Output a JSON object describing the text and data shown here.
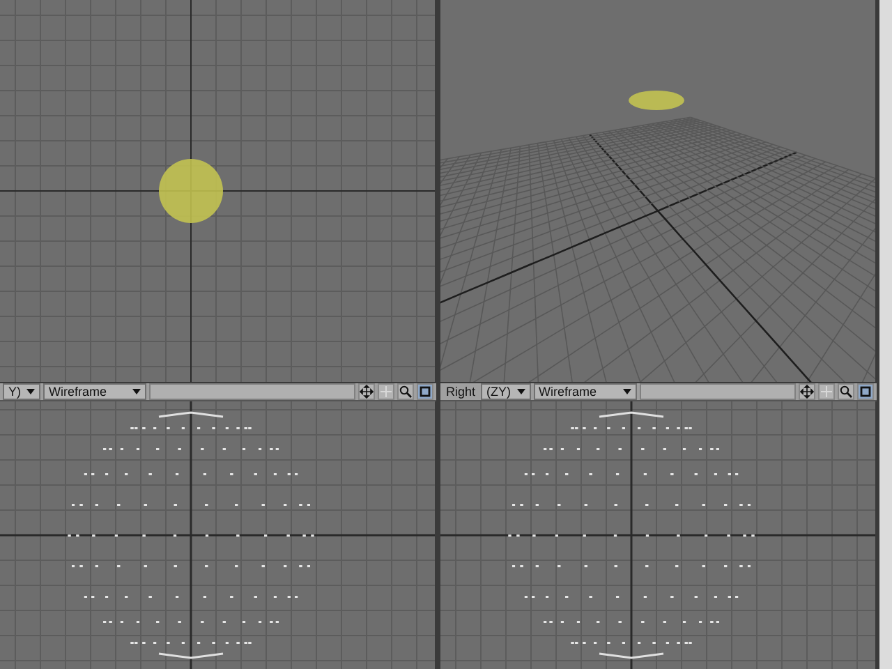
{
  "viewports": [
    {
      "kind": "top"
    },
    {
      "kind": "perspective"
    },
    {
      "kind": "front",
      "toolbar": {
        "view": "Y)",
        "mode": "Wireframe"
      }
    },
    {
      "kind": "side",
      "toolbar": {
        "label": "Right",
        "view": "(ZY)",
        "mode": "Wireframe"
      }
    }
  ]
}
